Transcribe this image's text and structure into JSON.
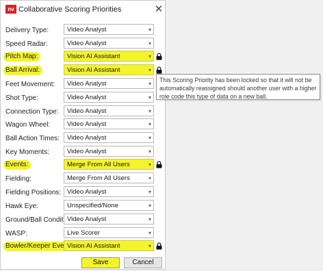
{
  "window": {
    "logo_text": "nv",
    "title": "Collaborative Scoring Priorities"
  },
  "rows": [
    {
      "label": "Delivery Type:",
      "value": "Video Analyst",
      "locked": false,
      "highlighted": false
    },
    {
      "label": "Speed Radar:",
      "value": "Video Analyst",
      "locked": false,
      "highlighted": false
    },
    {
      "label": "Pitch Map:",
      "value": "Vision AI Assistant",
      "locked": true,
      "highlighted": true
    },
    {
      "label": "Ball Arrival:",
      "value": "Vision AI Assistant",
      "locked": true,
      "highlighted": true
    },
    {
      "label": "Feet Movement:",
      "value": "Video Analyst",
      "locked": false,
      "highlighted": false
    },
    {
      "label": "Shot Type:",
      "value": "Video Analyst",
      "locked": false,
      "highlighted": false
    },
    {
      "label": "Connection Type:",
      "value": "Video Analyst",
      "locked": false,
      "highlighted": false
    },
    {
      "label": "Wagon Wheel:",
      "value": "Video Analyst",
      "locked": false,
      "highlighted": false
    },
    {
      "label": "Ball Action Times:",
      "value": "Video Analyst",
      "locked": false,
      "highlighted": false
    },
    {
      "label": "Key Moments:",
      "value": "Video Analyst",
      "locked": false,
      "highlighted": false
    },
    {
      "label": "Events:",
      "value": "Merge From All Users",
      "locked": true,
      "highlighted": true
    },
    {
      "label": "Fielding:",
      "value": "Merge From All Users",
      "locked": false,
      "highlighted": false
    },
    {
      "label": "Fielding Positions:",
      "value": "Video Analyst",
      "locked": false,
      "highlighted": false
    },
    {
      "label": "Hawk Eye:",
      "value": "Unspecified/None",
      "locked": false,
      "highlighted": false
    },
    {
      "label": "Ground/Ball Conditions:",
      "value": "Video Analyst",
      "locked": false,
      "highlighted": false
    },
    {
      "label": "WASP:",
      "value": "Live Scorer",
      "locked": false,
      "highlighted": false
    },
    {
      "label": "Bowler/Keeper Events:",
      "value": "Vision AI Assistant",
      "locked": true,
      "highlighted": true
    }
  ],
  "tooltip": {
    "text": "This Scoring Priority has been locked so that it will not be automatically reassigned should another user with a higher role code this type of data on a new ball."
  },
  "buttons": {
    "save": "Save",
    "cancel": "Cancel"
  },
  "colors": {
    "highlight": "#f4f42a",
    "logo": "#d8232a"
  },
  "icons": {
    "dropdown": "chevron-down-icon",
    "lock": "lock-icon",
    "close": "close-icon"
  }
}
